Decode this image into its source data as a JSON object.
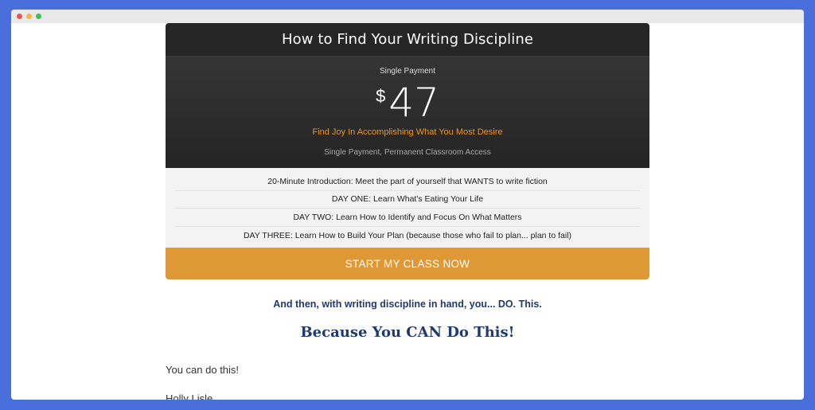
{
  "card": {
    "title": "How to Find Your Writing Discipline",
    "price_label": "Single Payment",
    "currency": "$",
    "amount": "47",
    "tagline": "Find Joy In Accomplishing What You Most Desire",
    "access": "Single Payment, Permanent Classroom Access",
    "features": [
      "20-Minute Introduction: Meet the part of yourself that WANTS to write fiction",
      "DAY ONE: Learn What's Eating Your Life",
      "DAY TWO: Learn How to Identify and Focus On What Matters",
      "DAY THREE: Learn How to Build Your Plan (because those who fail to plan... plan to fail)"
    ],
    "cta_label": "START MY CLASS NOW"
  },
  "body": {
    "lead": "And then, with writing discipline in hand, you... DO. This.",
    "heading": "Because You CAN Do This!",
    "paragraph1": "You can do this!",
    "paragraph2": "Holly Lisle"
  },
  "colors": {
    "accent": "#df9836",
    "navy": "#1f3a6e",
    "dark": "#262626"
  }
}
